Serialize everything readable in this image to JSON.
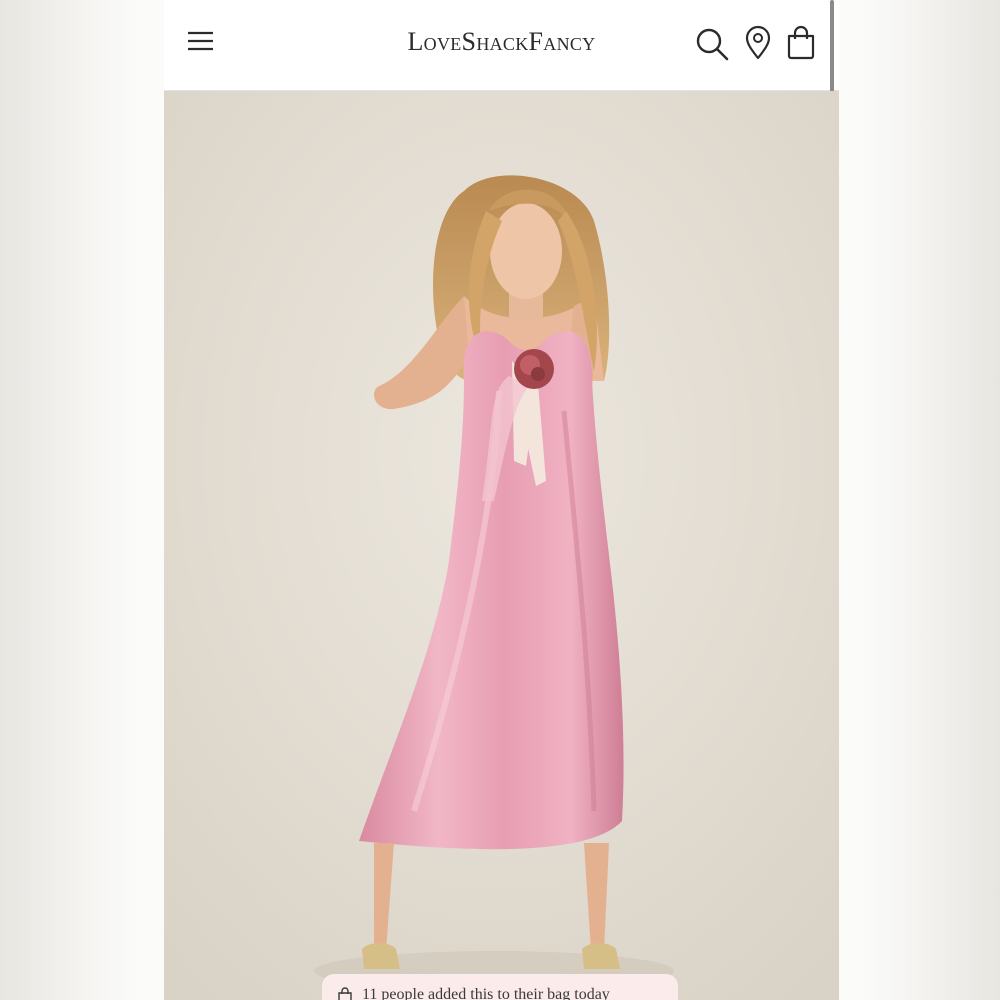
{
  "header": {
    "brand": "LoveShackFancy",
    "menu_icon": "hamburger-menu-icon",
    "search_icon": "search-icon",
    "location_icon": "location-pin-icon",
    "bag_icon": "shopping-bag-icon"
  },
  "product_image": {
    "dress_color": "#e8a0b4",
    "background_color": "#e6e0d7"
  },
  "toast": {
    "icon": "shopping-bag-icon",
    "text": "11 people added this to their bag today"
  },
  "colors": {
    "text": "#2b2b2b",
    "toast_bg": "#fbeceb"
  }
}
